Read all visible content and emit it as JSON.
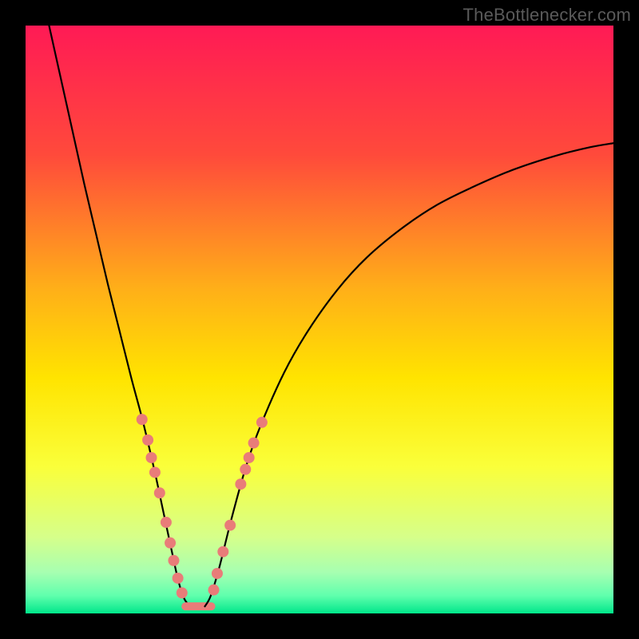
{
  "watermark": {
    "text": "TheBottlenecker.com"
  },
  "chart_data": {
    "type": "line",
    "title": "",
    "xlabel": "",
    "ylabel": "",
    "xlim": [
      0,
      100
    ],
    "ylim": [
      0,
      100
    ],
    "background_gradient": {
      "stops": [
        {
          "offset": 0.0,
          "color": "#ff1a55"
        },
        {
          "offset": 0.22,
          "color": "#ff4a3b"
        },
        {
          "offset": 0.45,
          "color": "#ffb018"
        },
        {
          "offset": 0.6,
          "color": "#ffe400"
        },
        {
          "offset": 0.75,
          "color": "#faff3a"
        },
        {
          "offset": 0.87,
          "color": "#d6ff8a"
        },
        {
          "offset": 0.93,
          "color": "#a7ffb1"
        },
        {
          "offset": 0.97,
          "color": "#5fffad"
        },
        {
          "offset": 1.0,
          "color": "#00e68a"
        }
      ]
    },
    "series": [
      {
        "name": "left-curve",
        "type": "line",
        "stroke": "#000000",
        "stroke_width": 2.2,
        "comment": "descending branch from upper-left toward trough near x≈27",
        "points": [
          {
            "x": 4.0,
            "y": 100.0
          },
          {
            "x": 6.0,
            "y": 91.0
          },
          {
            "x": 8.0,
            "y": 82.0
          },
          {
            "x": 10.0,
            "y": 73.0
          },
          {
            "x": 12.0,
            "y": 64.5
          },
          {
            "x": 14.0,
            "y": 56.0
          },
          {
            "x": 16.0,
            "y": 48.0
          },
          {
            "x": 18.0,
            "y": 40.0
          },
          {
            "x": 20.0,
            "y": 32.5
          },
          {
            "x": 22.0,
            "y": 24.0
          },
          {
            "x": 23.5,
            "y": 17.0
          },
          {
            "x": 25.0,
            "y": 10.0
          },
          {
            "x": 26.0,
            "y": 5.5
          },
          {
            "x": 27.0,
            "y": 2.5
          },
          {
            "x": 28.0,
            "y": 1.2
          }
        ]
      },
      {
        "name": "trough-segment",
        "type": "line",
        "stroke": "#e97c79",
        "stroke_width": 10,
        "comment": "short flat pink segment at the bottom of the V",
        "points": [
          {
            "x": 27.2,
            "y": 1.2
          },
          {
            "x": 31.6,
            "y": 1.2
          }
        ]
      },
      {
        "name": "right-curve",
        "type": "line",
        "stroke": "#000000",
        "stroke_width": 2.2,
        "comment": "ascending branch from trough rising and flattening toward the right",
        "points": [
          {
            "x": 30.5,
            "y": 1.2
          },
          {
            "x": 31.5,
            "y": 3.0
          },
          {
            "x": 33.0,
            "y": 8.0
          },
          {
            "x": 35.0,
            "y": 16.0
          },
          {
            "x": 37.5,
            "y": 25.0
          },
          {
            "x": 40.0,
            "y": 32.0
          },
          {
            "x": 44.0,
            "y": 41.0
          },
          {
            "x": 48.0,
            "y": 48.0
          },
          {
            "x": 53.0,
            "y": 55.0
          },
          {
            "x": 58.0,
            "y": 60.5
          },
          {
            "x": 64.0,
            "y": 65.5
          },
          {
            "x": 70.0,
            "y": 69.5
          },
          {
            "x": 76.0,
            "y": 72.5
          },
          {
            "x": 83.0,
            "y": 75.5
          },
          {
            "x": 90.0,
            "y": 77.8
          },
          {
            "x": 96.0,
            "y": 79.3
          },
          {
            "x": 100.0,
            "y": 80.0
          }
        ]
      }
    ],
    "scatter": {
      "name": "highlight-dots",
      "stroke": "#e97c79",
      "radius": 7,
      "comment": "pink markers clustered along lower parts of both branches",
      "points": [
        {
          "x": 19.8,
          "y": 33.0
        },
        {
          "x": 20.8,
          "y": 29.5
        },
        {
          "x": 21.4,
          "y": 26.5
        },
        {
          "x": 22.0,
          "y": 24.0
        },
        {
          "x": 22.8,
          "y": 20.5
        },
        {
          "x": 23.9,
          "y": 15.5
        },
        {
          "x": 24.6,
          "y": 12.0
        },
        {
          "x": 25.2,
          "y": 9.0
        },
        {
          "x": 25.9,
          "y": 6.0
        },
        {
          "x": 26.6,
          "y": 3.5
        },
        {
          "x": 32.0,
          "y": 4.0
        },
        {
          "x": 32.6,
          "y": 6.8
        },
        {
          "x": 33.6,
          "y": 10.5
        },
        {
          "x": 34.8,
          "y": 15.0
        },
        {
          "x": 36.6,
          "y": 22.0
        },
        {
          "x": 37.4,
          "y": 24.5
        },
        {
          "x": 38.0,
          "y": 26.5
        },
        {
          "x": 38.8,
          "y": 29.0
        },
        {
          "x": 40.2,
          "y": 32.5
        }
      ]
    }
  }
}
